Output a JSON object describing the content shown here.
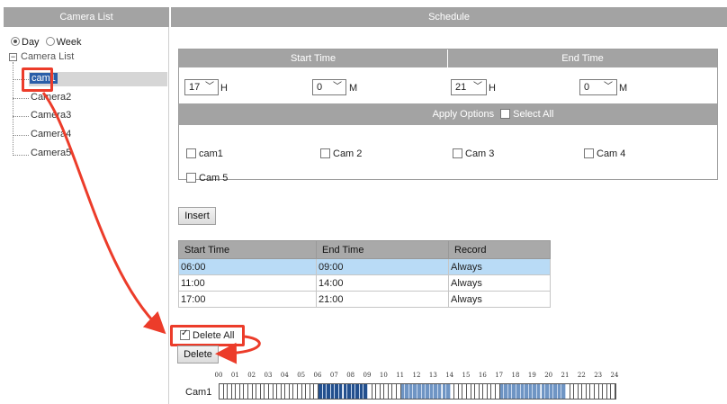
{
  "left": {
    "header": "Camera List",
    "mode_day": "Day",
    "mode_week": "Week",
    "tree_root": "Camera List",
    "cameras": [
      "cam1",
      "Camera2",
      "Camera3",
      "Camera4",
      "Camera5"
    ]
  },
  "right": {
    "header": "Schedule",
    "start_time_label": "Start Time",
    "end_time_label": "End Time",
    "start_hour": "17",
    "start_min": "0",
    "end_hour": "21",
    "end_min": "0",
    "unit_h": "H",
    "unit_m": "M",
    "apply_options": "Apply Options",
    "select_all": "Select All",
    "cam_options": [
      "cam1",
      "Cam 2",
      "Cam 3",
      "Cam 4",
      "Cam 5"
    ],
    "insert_label": "Insert",
    "table": {
      "headers": [
        "Start Time",
        "End Time",
        "Record"
      ],
      "rows": [
        [
          "06:00",
          "09:00",
          "Always"
        ],
        [
          "11:00",
          "14:00",
          "Always"
        ],
        [
          "17:00",
          "21:00",
          "Always"
        ]
      ]
    },
    "delete_all_label": "Delete All",
    "delete_label": "Delete",
    "timeline": {
      "label": "Cam1",
      "hours": [
        "00",
        "01",
        "02",
        "03",
        "04",
        "05",
        "06",
        "07",
        "08",
        "09",
        "10",
        "11",
        "12",
        "13",
        "14",
        "15",
        "16",
        "17",
        "18",
        "19",
        "20",
        "21",
        "22",
        "23",
        "24"
      ],
      "scheduled": [
        [
          6,
          9
        ],
        [
          11,
          14
        ],
        [
          17,
          21
        ]
      ]
    }
  },
  "colors": {
    "header_gray": "#a3a3a3",
    "highlight_blue": "#b9dbf6",
    "annotation_red": "#ec3c2a",
    "selected_blue": "#2a5ea8",
    "schedule_fill": "#3f6fa8"
  }
}
